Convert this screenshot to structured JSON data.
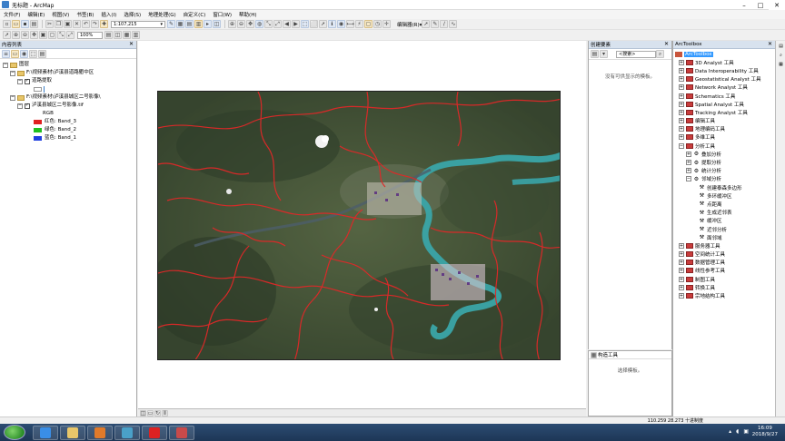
{
  "window": {
    "title": "无标题 - ArcMap"
  },
  "window_controls": {
    "minimize": "–",
    "maximize": "□",
    "close": "✕"
  },
  "menu": [
    "文件(F)",
    "编辑(E)",
    "视图(V)",
    "书签(B)",
    "插入(I)",
    "选择(S)",
    "地理处理(G)",
    "自定义(C)",
    "窗口(W)",
    "帮助(H)"
  ],
  "toolbar": {
    "scale_value": "1:107,215",
    "zoom_value": "100%",
    "editor_label": "编辑器(R)▾"
  },
  "toc": {
    "header": "内容列表",
    "close": "✕",
    "root_label": "图层",
    "group1_label": "F:\\视频素材\\泸溪县道路衢中区",
    "layer1_label": "道路提取",
    "group2_label": "F:\\视频素材\\泸溪县城区二号影像\\",
    "layer2_label": "泸溪县城区二号影像.tif",
    "rgb_label": "RGB",
    "bands": [
      {
        "label": "红色:  Band_3",
        "color": "#e02020"
      },
      {
        "label": "绿色:  Band_2",
        "color": "#20c020"
      },
      {
        "label": "蓝色:  Band_1",
        "color": "#2040e0"
      }
    ]
  },
  "create_features": {
    "header": "创建要素",
    "close": "✕",
    "search_placeholder": "<搜索>",
    "empty_message": "没有可供显示的模板。"
  },
  "construct_tools": {
    "header": "构造工具",
    "message": "选择模板。"
  },
  "toolbox": {
    "header": "ArcToolbox",
    "close": "✕",
    "root": "ArcToolbox",
    "items": [
      "3D Analyst 工具",
      "Data Interoperability 工具",
      "Geostatistical Analyst 工具",
      "Network Analyst 工具",
      "Schematics 工具",
      "Spatial Analyst 工具",
      "Tracking Analyst 工具",
      "编辑工具",
      "地理编码工具",
      "多维工具"
    ],
    "analysis": {
      "label": "分析工具",
      "subsets": [
        "叠加分析",
        "提取分析",
        "统计分析"
      ],
      "proximity": {
        "label": "邻域分析",
        "tools": [
          "创建泰森多边形",
          "多环缓冲区",
          "点距离",
          "生成近邻表",
          "缓冲区",
          "近邻分析",
          "面邻域"
        ]
      }
    },
    "items_after": [
      "服务器工具",
      "空间统计工具",
      "数据管理工具",
      "线性参考工具",
      "制图工具",
      "转换工具",
      "宗地结构工具"
    ]
  },
  "status": {
    "coords": "110.259  28.273 十进制度"
  },
  "taskbar": {
    "time": "16:09",
    "date": "2018/9/27"
  }
}
